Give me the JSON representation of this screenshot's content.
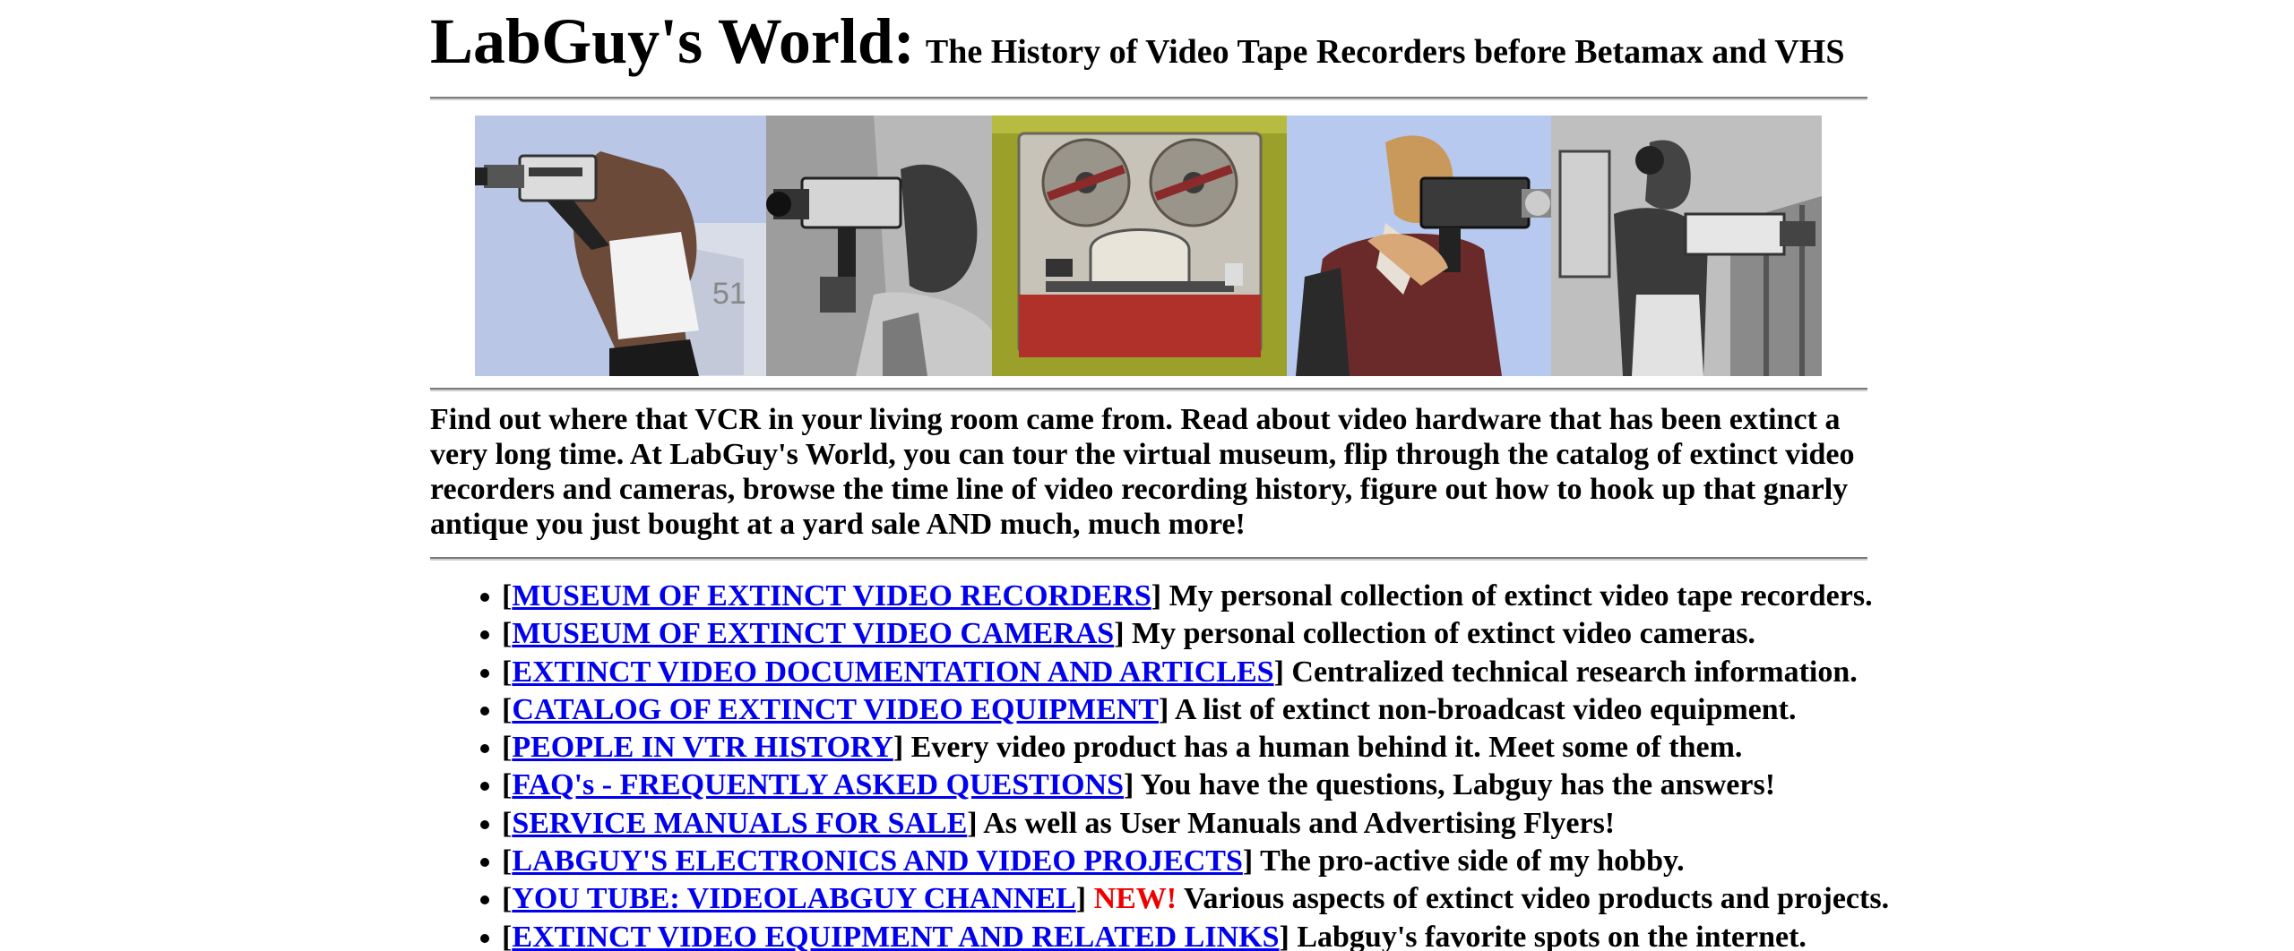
{
  "header": {
    "title": "LabGuy's World:",
    "subtitle": "The History of Video Tape Recorders before Betamax and VHS"
  },
  "banner": {
    "panels": [
      {
        "name": "woman-with-camera-photo",
        "bg": "#b9c6e6"
      },
      {
        "name": "man-with-camera-photo",
        "bg": "#9d9d9d"
      },
      {
        "name": "reel-to-reel-recorder-photo",
        "bg": "#9aa02a"
      },
      {
        "name": "man-in-red-shirt-with-camera-photo",
        "bg": "#b7c9ee"
      },
      {
        "name": "man-with-backpack-recorder-photo",
        "bg": "#bfbfbf"
      }
    ]
  },
  "intro": {
    "text": "Find out where that VCR in your living room came from. Read about video hardware that has been extinct a very long time. At LabGuy's World, you can tour the virtual museum, flip through the catalog of extinct video recorders and cameras, browse the time line of video recording history, figure out how to hook up that gnarly antique you just bought at a yard sale AND much, much more!"
  },
  "links": [
    {
      "open": "[",
      "label": "MUSEUM OF EXTINCT VIDEO RECORDERS",
      "close": "]",
      "badge": "",
      "desc": " My personal collection of extinct video tape recorders."
    },
    {
      "open": "[",
      "label": "MUSEUM OF EXTINCT VIDEO CAMERAS",
      "close": "]",
      "badge": "",
      "desc": " My personal collection of extinct video cameras."
    },
    {
      "open": "[",
      "label": "EXTINCT VIDEO DOCUMENTATION AND ARTICLES",
      "close": "]",
      "badge": "",
      "desc": " Centralized technical research information."
    },
    {
      "open": "[",
      "label": "CATALOG OF EXTINCT VIDEO EQUIPMENT",
      "close": "]",
      "badge": "",
      "desc": " A list of extinct non-broadcast video equipment."
    },
    {
      "open": "[",
      "label": "PEOPLE IN VTR HISTORY",
      "close": "]",
      "badge": "",
      "desc": " Every video product has a human behind it. Meet some of them."
    },
    {
      "open": "[",
      "label": "FAQ's - FREQUENTLY ASKED QUESTIONS",
      "close": "]",
      "badge": "",
      "desc": " You have the questions, Labguy has the answers!"
    },
    {
      "open": "[",
      "label": "SERVICE MANUALS FOR SALE",
      "close": "]",
      "badge": "",
      "desc": " As well as User Manuals and Advertising Flyers!"
    },
    {
      "open": "[",
      "label": "LABGUY'S ELECTRONICS AND VIDEO PROJECTS",
      "close": "]",
      "badge": "",
      "desc": " The pro-active side of my hobby."
    },
    {
      "open": "[",
      "label": "YOU TUBE: VIDEOLABGUY CHANNEL",
      "close": "]",
      "badge": " NEW!",
      "desc": " Various aspects of extinct video products and projects."
    },
    {
      "open": "[",
      "label": "EXTINCT VIDEO EQUIPMENT AND RELATED LINKS",
      "close": "]",
      "badge": "",
      "desc": " Labguy's favorite spots on the internet."
    }
  ],
  "colors": {
    "link": "#0000ee",
    "new_badge": "#ee0000",
    "rule": "#7a7a7a"
  }
}
